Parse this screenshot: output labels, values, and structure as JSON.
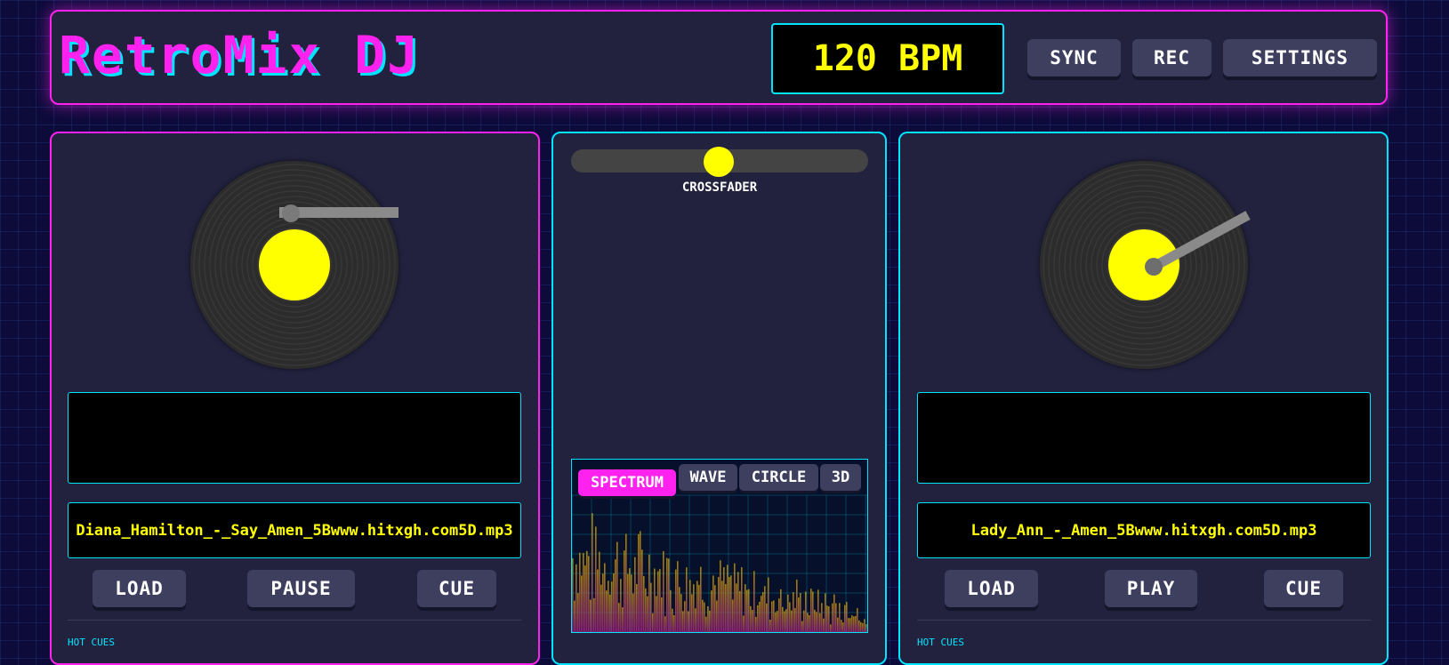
{
  "header": {
    "title": "RetroMix DJ",
    "bpm": "120 BPM",
    "buttons": {
      "sync": "SYNC",
      "rec": "REC",
      "settings": "SETTINGS"
    }
  },
  "deck_a": {
    "track": "Diana_Hamilton_-_Say_Amen_5Bwww.hitxgh.com5D.mp3",
    "buttons": {
      "load": "LOAD",
      "play_pause": "PAUSE",
      "cue": "CUE"
    },
    "hot_cues_label": "HOT CUES"
  },
  "deck_b": {
    "track": "Lady_Ann_-_Amen_5Bwww.hitxgh.com5D.mp3",
    "buttons": {
      "load": "LOAD",
      "play_pause": "PLAY",
      "cue": "CUE"
    },
    "hot_cues_label": "HOT CUES"
  },
  "mixer": {
    "crossfader_label": "CROSSFADER",
    "crossfader_position": 0.5,
    "viz_tabs": [
      "SPECTRUM",
      "WAVE",
      "CIRCLE",
      "3D"
    ],
    "viz_active": "SPECTRUM"
  },
  "colors": {
    "accent_pink": "#ff22ee",
    "accent_cyan": "#00e5ff",
    "accent_yellow": "#ffff00",
    "panel": "#22223f"
  }
}
